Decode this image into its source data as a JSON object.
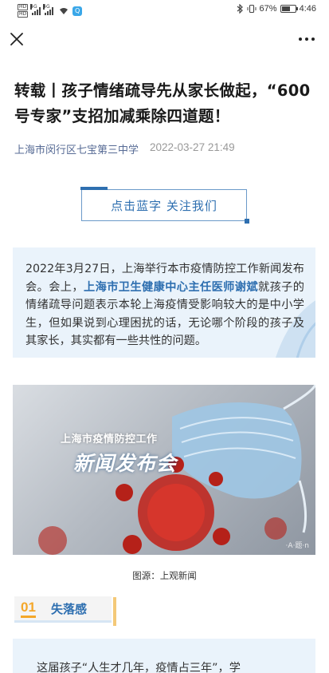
{
  "status_bar": {
    "network_hd_top": "HD",
    "network_hd_bottom": "HD",
    "signal1_gen": "4G",
    "signal2_gen": "4G",
    "app_badge": "Q",
    "battery_percent": "67%",
    "battery_level": 0.67,
    "time": "4:46"
  },
  "nav": {
    "close_icon": "close-icon",
    "more_icon": "more-icon"
  },
  "article": {
    "title": "转载丨孩子情绪疏导先从家长做起，“600号专家”支招加减乘除四道题！",
    "source": "上海市闵行区七宝第三中学",
    "date": "2022-03-27 21:49",
    "follow_label": "点击蓝字 关注我们",
    "intro": {
      "before": "2022年3月27日，上海举行本市疫情防控工作新闻发布会。会上，",
      "bold": "上海市卫生健康中心主任医师谢斌",
      "after": "就孩子的情绪疏导问题表示本轮上海疫情受影响较大的是中小学生，但如果说到心理困扰的话，无论哪个阶段的孩子及其家长，其实都有一些共性的问题。"
    },
    "image": {
      "headline_small": "上海市疫情防控工作",
      "headline_large": "新闻发布会",
      "watermark": "·A·题·n"
    },
    "caption": "图源：上观新闻",
    "section": {
      "number": "01",
      "label": "失落感"
    },
    "paragraph_start": "这届孩子“人生才几年，疫情占三年”，学"
  },
  "colors": {
    "accent_blue": "#2e6fb0",
    "link_blue": "#576b95",
    "section_orange": "#f4a72a",
    "box_bg": "#eaf3fb"
  }
}
